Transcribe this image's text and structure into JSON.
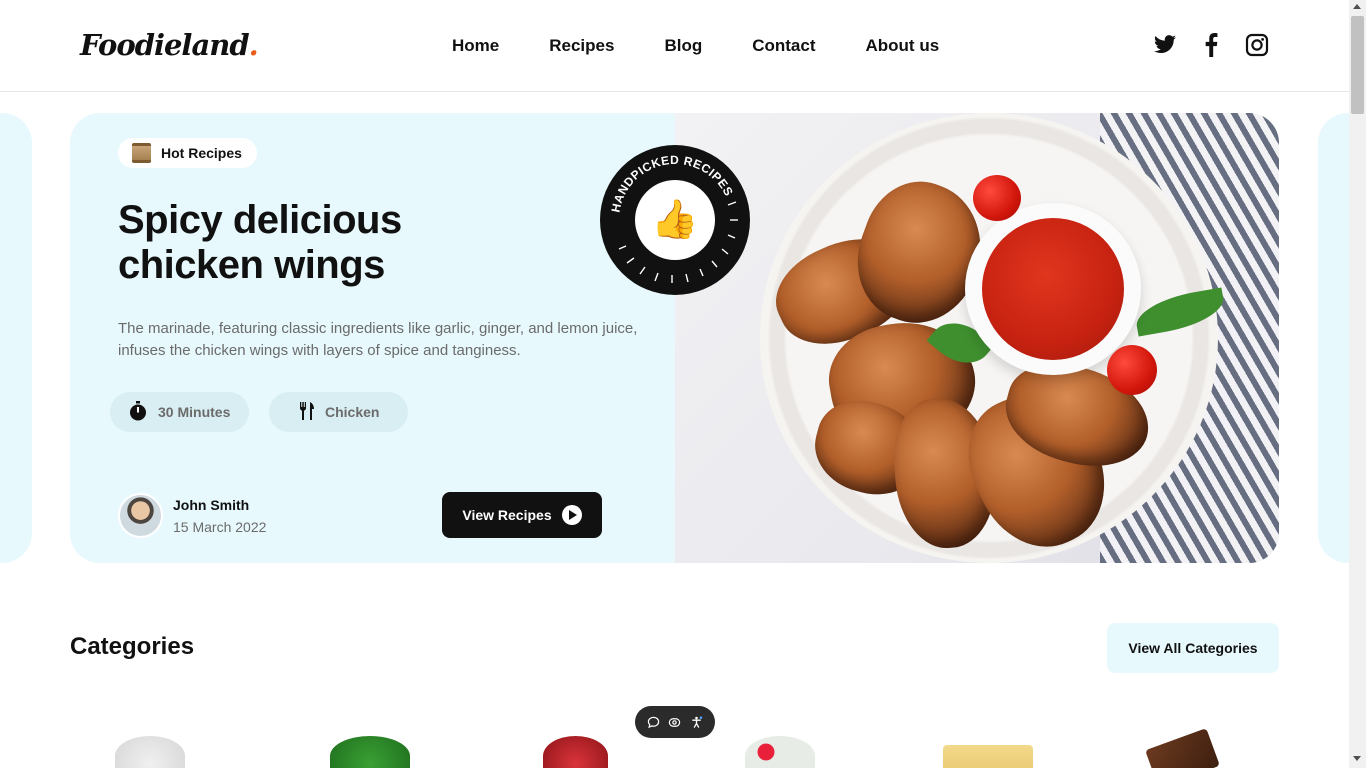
{
  "header": {
    "logo": "Foodieland",
    "logo_dot": ".",
    "nav": [
      "Home",
      "Recipes",
      "Blog",
      "Contact",
      "About us"
    ],
    "social_icons": [
      "twitter-icon",
      "facebook-icon",
      "instagram-icon"
    ]
  },
  "hero": {
    "tag": "Hot Recipes",
    "title_line1": "Spicy delicious",
    "title_line2": "chicken wings",
    "description": "The marinade, featuring classic ingredients like garlic, ginger, and lemon juice, infuses the chicken wings with layers of spice and tanginess.",
    "time": "30 Minutes",
    "category": "Chicken",
    "author_name": "John Smith",
    "author_date": "15 March 2022",
    "button": "View Recipes",
    "stamp_text": "HANDPICKED RECIPES"
  },
  "categories": {
    "title": "Categories",
    "button": "View All Categories"
  },
  "colors": {
    "hero_bg": "#e7f9fd",
    "accent": "#e85d1c",
    "dark": "#111111"
  }
}
